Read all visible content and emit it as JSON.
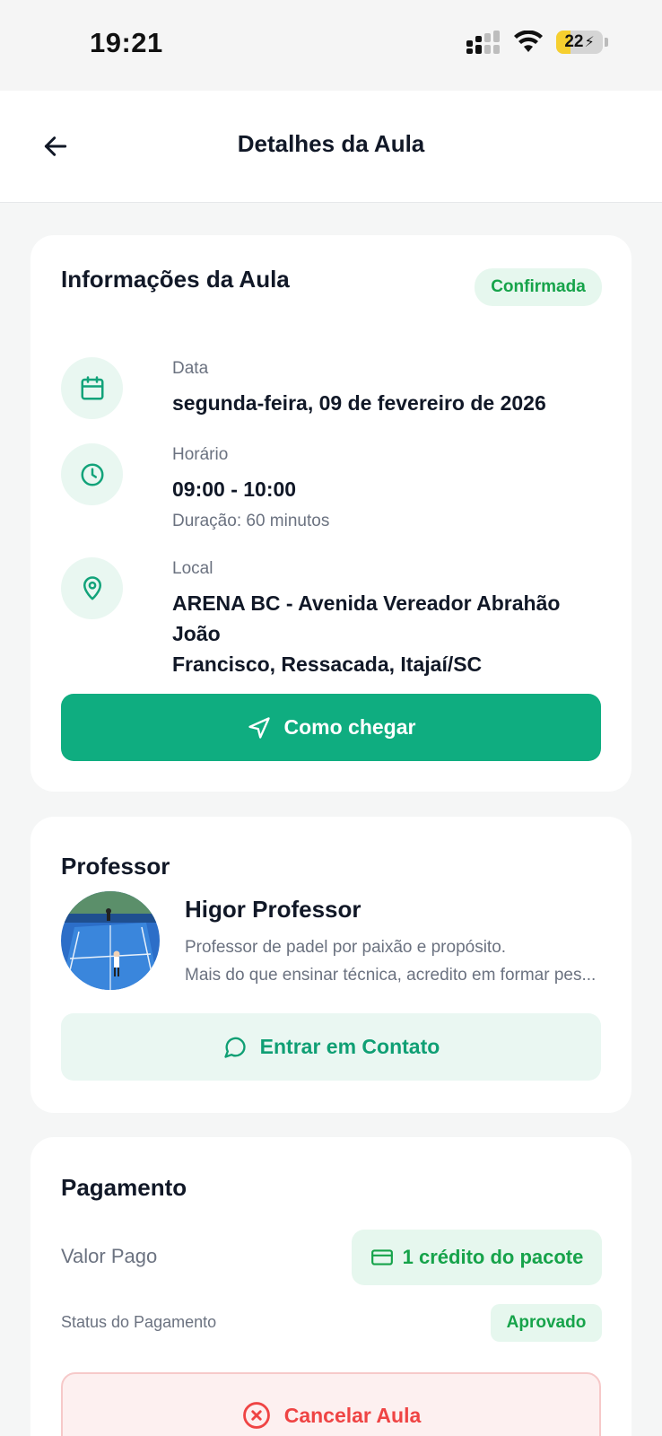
{
  "status_bar": {
    "time": "19:21",
    "battery": "22"
  },
  "header": {
    "title": "Detalhes da Aula"
  },
  "class_info": {
    "title": "Informações da Aula",
    "status": "Confirmada",
    "date_label": "Data",
    "date_value": "segunda-feira, 09 de fevereiro de 2026",
    "time_label": "Horário",
    "time_value": "09:00 - 10:00",
    "duration": "Duração: 60 minutos",
    "location_label": "Local",
    "location_line1": "ARENA BC - Avenida Vereador Abrahão João",
    "location_line2": "Francisco, Ressacada, Itajaí/SC",
    "directions_button": "Como chegar"
  },
  "professor": {
    "section_title": "Professor",
    "name": "Higor Professor",
    "bio_line1": "Professor de padel por paixão e propósito.",
    "bio_line2": "Mais do que ensinar técnica, acredito em formar pes...",
    "contact_button": "Entrar em Contato"
  },
  "payment": {
    "section_title": "Pagamento",
    "amount_label": "Valor Pago",
    "amount_value": "1 crédito do pacote",
    "status_label": "Status do Pagamento",
    "status_value": "Aprovado",
    "cancel_button": "Cancelar Aula"
  },
  "colors": {
    "primary": "#0fad80",
    "success_text": "#16a34a",
    "danger": "#ef4444",
    "background": "#f5f6f6"
  }
}
